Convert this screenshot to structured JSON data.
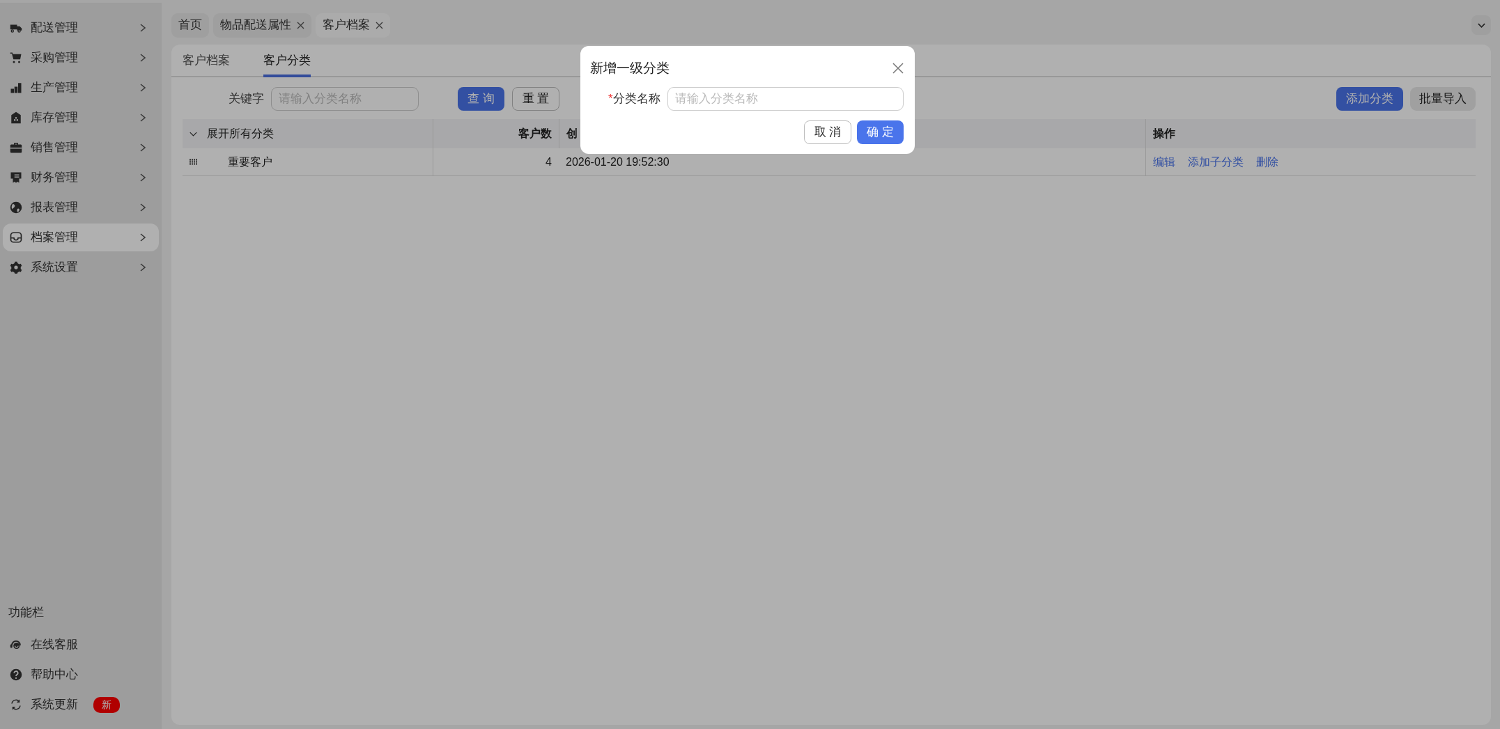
{
  "sidebar": {
    "items": [
      {
        "label": "配送管理",
        "selected": false
      },
      {
        "label": "采购管理",
        "selected": false
      },
      {
        "label": "生产管理",
        "selected": false
      },
      {
        "label": "库存管理",
        "selected": false
      },
      {
        "label": "销售管理",
        "selected": false
      },
      {
        "label": "财务管理",
        "selected": false
      },
      {
        "label": "报表管理",
        "selected": false
      },
      {
        "label": "档案管理",
        "selected": true
      },
      {
        "label": "系统设置",
        "selected": false
      }
    ],
    "footer": {
      "title": "功能栏",
      "items": [
        {
          "label": "在线客服"
        },
        {
          "label": "帮助中心"
        },
        {
          "label": "系统更新",
          "badge": "新"
        }
      ]
    }
  },
  "page_tabs": [
    {
      "label": "首页",
      "closable": false,
      "selected": false
    },
    {
      "label": "物品配送属性",
      "closable": true,
      "selected": false
    },
    {
      "label": "客户档案",
      "closable": true,
      "selected": true
    }
  ],
  "sub_tabs": [
    {
      "label": "客户档案",
      "selected": false
    },
    {
      "label": "客户分类",
      "selected": true
    }
  ],
  "filter": {
    "label": "关键字",
    "placeholder": "请输入分类名称",
    "buttons": [
      {
        "label": "查 询",
        "kind": "primary"
      },
      {
        "label": "重 置",
        "kind": "outline"
      }
    ]
  },
  "toolbar_buttons": [
    {
      "label": "添加分类",
      "kind": "primary"
    },
    {
      "label": "批量导入",
      "kind": "secondary"
    }
  ],
  "table": {
    "columns": [
      {
        "label": "展开所有分类"
      },
      {
        "label": "客户数"
      },
      {
        "label": "创"
      },
      {
        "label": "操作"
      }
    ],
    "rows": [
      {
        "name": "重要客户",
        "count": "4",
        "created": "2026-01-20 19:52:30",
        "actions": [
          "编辑",
          "添加子分类",
          "删除"
        ]
      }
    ]
  },
  "modal": {
    "title": "新增一级分类",
    "field": {
      "required_mark": "*",
      "label": "分类名称",
      "placeholder": "请输入分类名称"
    },
    "buttons": [
      {
        "label": "取 消",
        "kind": "outline"
      },
      {
        "label": "确 定",
        "kind": "primary"
      }
    ]
  }
}
